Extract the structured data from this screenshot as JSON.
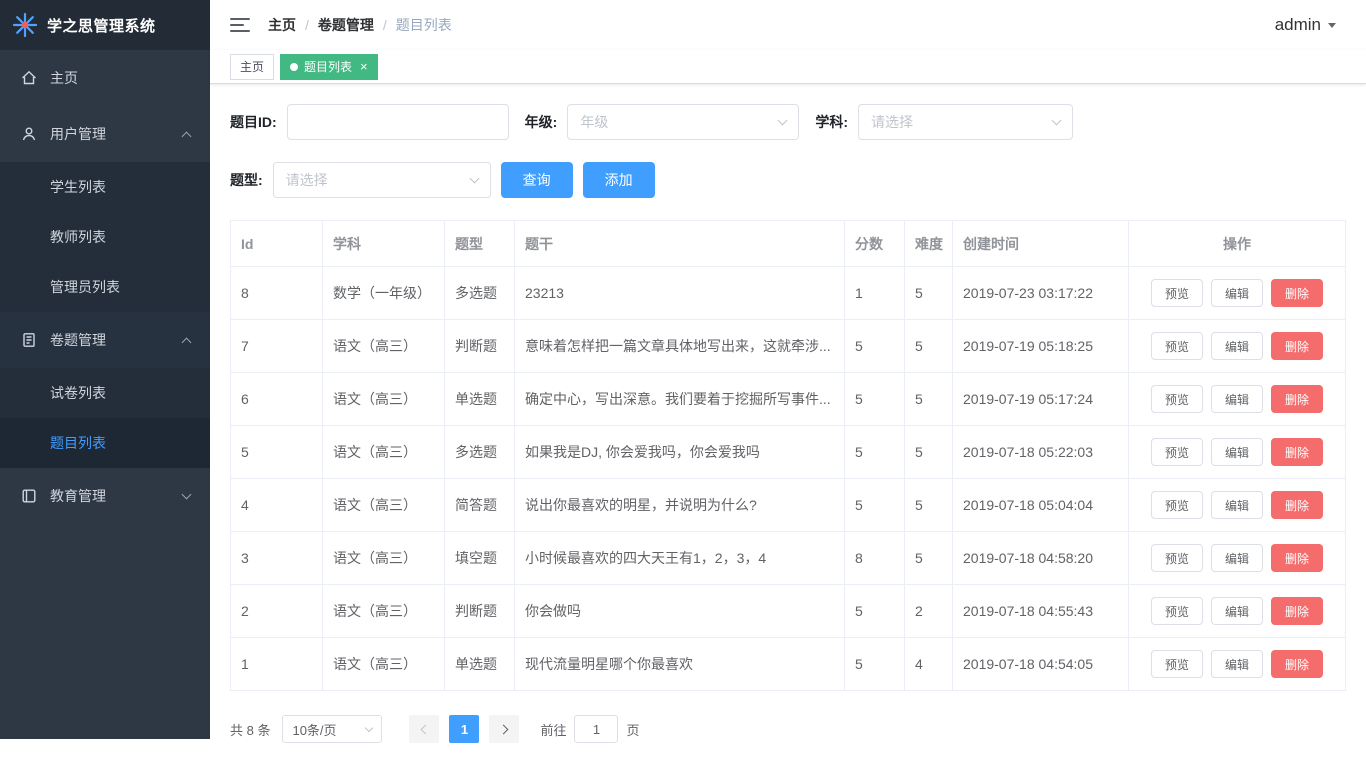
{
  "app": {
    "title": "学之思管理系统",
    "user": "admin"
  },
  "colors": {
    "accent": "#409EFF",
    "tab_active_green": "#42b983",
    "danger": "#f56c6c",
    "sidebar_bg": "#2e3845"
  },
  "icons": {
    "logo": "starburst-icon",
    "menu_toggle": "hamburger-icon",
    "home": "home-icon",
    "user_mgmt": "user-icon",
    "exam_mgmt": "document-icon",
    "edu_mgmt": "notebook-icon"
  },
  "breadcrumb": {
    "separator": "/",
    "items": [
      "主页",
      "卷题管理",
      "题目列表"
    ]
  },
  "tabs": [
    {
      "label": "主页"
    },
    {
      "label": "题目列表"
    }
  ],
  "sidebar": {
    "items": [
      {
        "label": "主页"
      },
      {
        "label": "用户管理",
        "children": [
          "学生列表",
          "教师列表",
          "管理员列表"
        ]
      },
      {
        "label": "卷题管理",
        "children": [
          "试卷列表",
          "题目列表"
        ]
      },
      {
        "label": "教育管理"
      }
    ],
    "active_item": "题目列表"
  },
  "filters": {
    "id_label": "题目ID:",
    "grade_label": "年级:",
    "grade_placeholder": "年级",
    "subject_label": "学科:",
    "subject_placeholder": "请选择",
    "type_label": "题型:",
    "type_placeholder": "请选择",
    "query_button": "查询",
    "add_button": "添加"
  },
  "table": {
    "columns": [
      "Id",
      "学科",
      "题型",
      "题干",
      "分数",
      "难度",
      "创建时间",
      "操作"
    ],
    "action_labels": [
      "预览",
      "编辑",
      "删除"
    ],
    "rows": [
      {
        "id": "8",
        "subject": "数学（一年级）",
        "qtype": "多选题",
        "stem": "23213",
        "score": "1",
        "difficulty": "5",
        "created": "2019-07-23 03:17:22"
      },
      {
        "id": "7",
        "subject": "语文（高三）",
        "qtype": "判断题",
        "stem": "意味着怎样把一篇文章具体地写出来，这就牵涉...",
        "score": "5",
        "difficulty": "5",
        "created": "2019-07-19 05:18:25"
      },
      {
        "id": "6",
        "subject": "语文（高三）",
        "qtype": "单选题",
        "stem": "确定中心，写出深意。我们要着于挖掘所写事件...",
        "score": "5",
        "difficulty": "5",
        "created": "2019-07-19 05:17:24"
      },
      {
        "id": "5",
        "subject": "语文（高三）",
        "qtype": "多选题",
        "stem": "如果我是DJ, 你会爱我吗，你会爱我吗",
        "score": "5",
        "difficulty": "5",
        "created": "2019-07-18 05:22:03"
      },
      {
        "id": "4",
        "subject": "语文（高三）",
        "qtype": "简答题",
        "stem": "说出你最喜欢的明星，并说明为什么?",
        "score": "5",
        "difficulty": "5",
        "created": "2019-07-18 05:04:04"
      },
      {
        "id": "3",
        "subject": "语文（高三）",
        "qtype": "填空题",
        "stem": "小时候最喜欢的四大天王有1，2，3，4",
        "score": "8",
        "difficulty": "5",
        "created": "2019-07-18 04:58:20"
      },
      {
        "id": "2",
        "subject": "语文（高三）",
        "qtype": "判断题",
        "stem": "你会做吗",
        "score": "5",
        "difficulty": "2",
        "created": "2019-07-18 04:55:43"
      },
      {
        "id": "1",
        "subject": "语文（高三）",
        "qtype": "单选题",
        "stem": "现代流量明星哪个你最喜欢",
        "score": "5",
        "difficulty": "4",
        "created": "2019-07-18 04:54:05"
      }
    ]
  },
  "pagination": {
    "total": "共 8 条",
    "page_size": "10条/页",
    "current_page": "1",
    "goto_label": "前往",
    "goto_value": "1",
    "page_unit": "页"
  }
}
